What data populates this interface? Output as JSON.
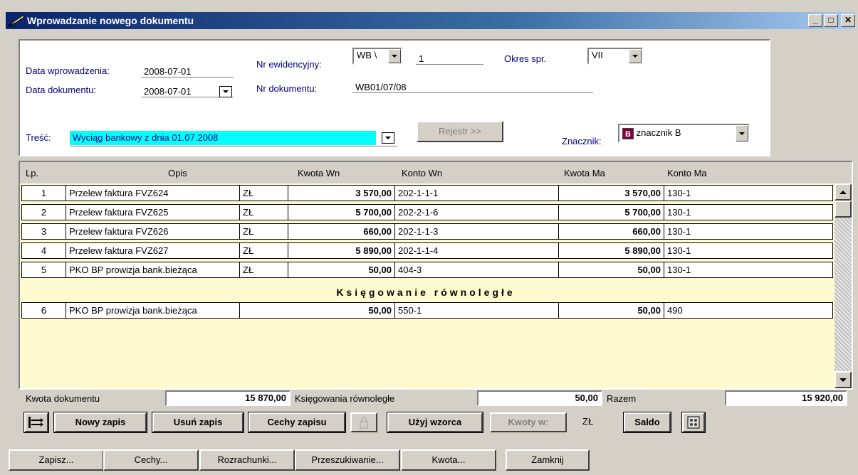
{
  "window": {
    "title": "Wprowadzanie nowego dokumentu",
    "min_label": "_",
    "max_label": "□",
    "close_label": "✕"
  },
  "header": {
    "data_wprowadzenia_label": "Data wprowadzenia:",
    "data_wprowadzenia_value": "2008-07-01",
    "data_dokumentu_label": "Data dokumentu:",
    "data_dokumentu_value": "2008-07-01",
    "nr_ewidencyjny_label": "Nr ewidencyjny:",
    "nr_ewidencyjny_prefix": "WB",
    "nr_ewidencyjny_prefix_suffix": "\\",
    "nr_ewidencyjny_value": "1",
    "okres_label": "Okres spr.",
    "okres_value": "VII",
    "nr_dokumentu_label": "Nr dokumentu:",
    "nr_dokumentu_value": "WB01/07/08",
    "tresc_label": "Treść:",
    "tresc_value": "Wyciąg bankowy z dnia 01.07.2008",
    "rejestr_label": "Rejestr >>",
    "znacznik_label": "Znacznik:",
    "znacznik_value": "znacznik B",
    "znacznik_badge": "B",
    "znacznik_color": "#800040"
  },
  "grid": {
    "columns": [
      "Lp.",
      "Opis",
      "Kwota Wn",
      "Konto Wn",
      "Kwota Ma",
      "Konto Ma"
    ],
    "rows": [
      {
        "lp": "1",
        "opis": "Przelew faktura FVZ624",
        "waluta": "ZŁ",
        "kwota_wn": "3 570,00",
        "konto_wn": "202-1-1-1",
        "kwota_ma": "3 570,00",
        "konto_ma": "130-1"
      },
      {
        "lp": "2",
        "opis": "Przelew faktura FVZ625",
        "waluta": "ZŁ",
        "kwota_wn": "5 700,00",
        "konto_wn": "202-2-1-6",
        "kwota_ma": "5 700,00",
        "konto_ma": "130-1"
      },
      {
        "lp": "3",
        "opis": "Przelew faktura FVZ626",
        "waluta": "ZŁ",
        "kwota_wn": "660,00",
        "konto_wn": "202-1-1-3",
        "kwota_ma": "660,00",
        "konto_ma": "130-1"
      },
      {
        "lp": "4",
        "opis": "Przelew faktura FVZ627",
        "waluta": "ZŁ",
        "kwota_wn": "5 890,00",
        "konto_wn": "202-1-1-4",
        "kwota_ma": "5 890,00",
        "konto_ma": "130-1"
      },
      {
        "lp": "5",
        "opis": "PKO BP prowizja bank.bieżąca",
        "waluta": "ZŁ",
        "kwota_wn": "50,00",
        "konto_wn": "404-3",
        "kwota_ma": "50,00",
        "konto_ma": "130-1"
      }
    ],
    "parallel_title": "Księgowanie równoległe",
    "parallel_rows": [
      {
        "lp": "6",
        "opis": "PKO BP prowizja bank.bieżąca",
        "kwota_wn": "50,00",
        "konto_wn": "550-1",
        "kwota_ma": "50,00",
        "konto_ma": "490"
      }
    ],
    "background_color": "#fffbd0"
  },
  "totals": {
    "kwota_dokumentu_label": "Kwota dokumentu",
    "kwota_dokumentu_value": "15 870,00",
    "ksiegowania_label": "Księgowania równoległe",
    "ksiegowania_value": "50,00",
    "razem_label": "Razem",
    "razem_value": "15 920,00"
  },
  "toolbar": {
    "nowy_zapis": "Nowy zapis",
    "usun_zapis": "Usuń zapis",
    "cechy_zapisu": "Cechy zapisu",
    "uzyj_wzorca": "Użyj wzorca",
    "kwoty_w": "Kwoty w:",
    "waluta": "ZŁ",
    "saldo": "Saldo"
  },
  "bottom": {
    "zapisz": "Zapisz...",
    "cechy": "Cechy...",
    "rozrachunki": "Rozrachunki...",
    "przeszukiwanie": "Przeszukiwanie...",
    "kwota": "Kwota...",
    "zamknij": "Zamknij"
  }
}
